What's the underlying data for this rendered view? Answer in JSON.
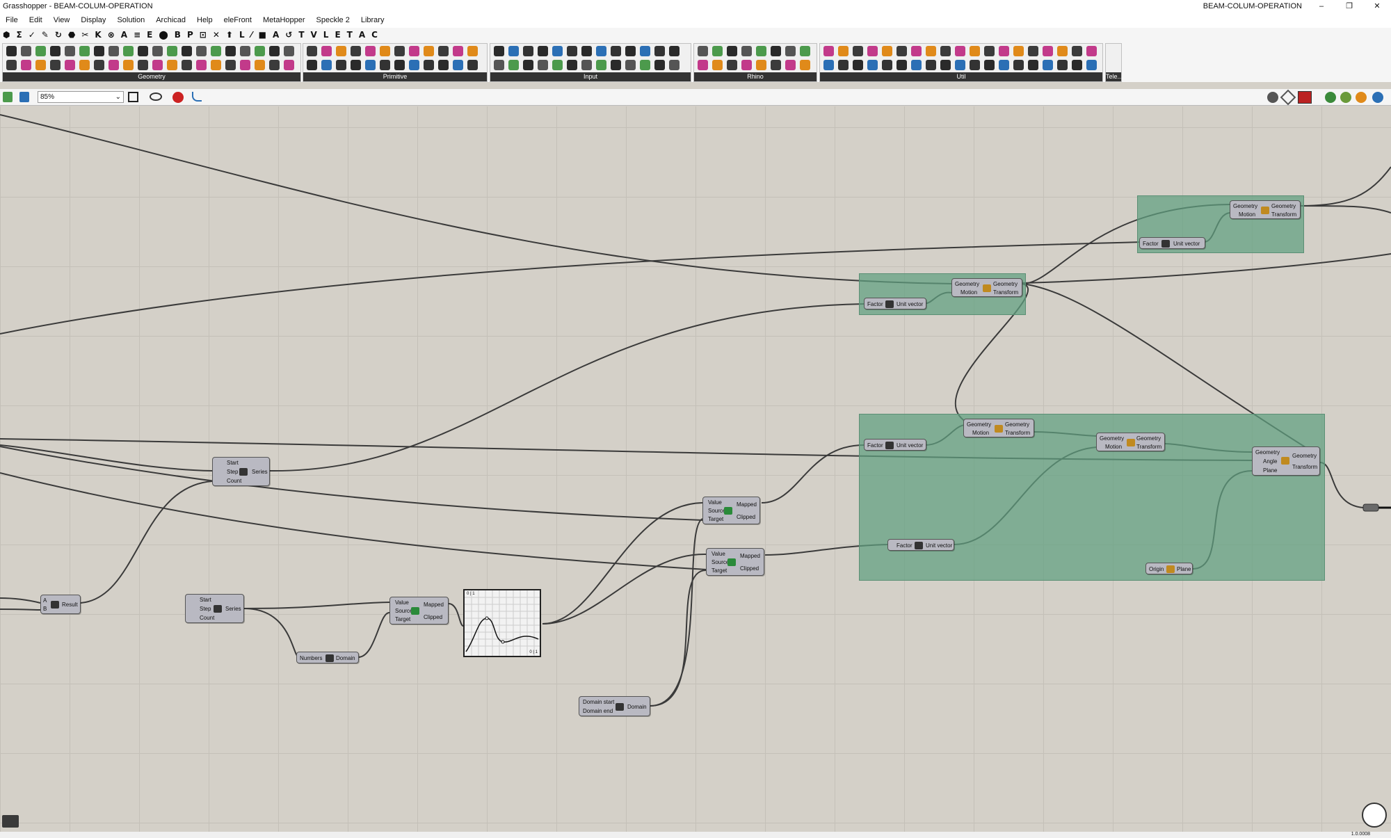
{
  "window": {
    "title": "Grasshopper - BEAM-COLUM-OPERATION",
    "document_name": "BEAM-COLUM-OPERATION",
    "buttons": [
      "–",
      "❐",
      "✕"
    ]
  },
  "menu": [
    "File",
    "Edit",
    "View",
    "Display",
    "Solution",
    "Archicad",
    "Help",
    "eleFront",
    "MetaHopper",
    "Speckle 2",
    "Library"
  ],
  "tabs": [
    "⬢",
    "Σ",
    "✓",
    "✎",
    "↻",
    "⬣",
    "✂",
    "K",
    "⊗",
    "A",
    "≡",
    "E",
    "⬤",
    "B",
    "P",
    "⊡",
    "✕",
    "⬆",
    "L",
    "⁄",
    "■",
    "A",
    "↺",
    "T",
    "V",
    "L",
    "E",
    "T",
    "A",
    "C"
  ],
  "ribbon": {
    "panels": [
      "Geometry",
      "Primitive",
      "Input",
      "Rhino",
      "Util",
      "Tele..."
    ]
  },
  "canvas_toolbar": {
    "zoom": "85%"
  },
  "nodes": {
    "multiply": {
      "in": [
        "A",
        "B"
      ],
      "out": "Result"
    },
    "series1": {
      "in": [
        "Start",
        "Step",
        "Count"
      ],
      "out": "Series"
    },
    "series2": {
      "in": [
        "Start",
        "Step",
        "Count"
      ],
      "out": "Series"
    },
    "bounds": {
      "in": "Numbers",
      "out": "Domain"
    },
    "remap1": {
      "in": [
        "Value",
        "Source",
        "Target"
      ],
      "out": [
        "Mapped",
        "Clipped"
      ]
    },
    "remap2": {
      "in": [
        "Value",
        "Source",
        "Target"
      ],
      "out": [
        "Mapped",
        "Clipped"
      ]
    },
    "remap3": {
      "in": [
        "Value",
        "Source",
        "Target"
      ],
      "out": [
        "Mapped",
        "Clipped"
      ]
    },
    "domain": {
      "in": [
        "Domain start",
        "Domain end"
      ],
      "out": "Domain"
    },
    "unit_z1": {
      "in": "Factor",
      "out": "Unit vector"
    },
    "unit_x1": {
      "in": "Factor",
      "out": "Unit vector"
    },
    "unit_z2": {
      "in": "Factor",
      "out": "Unit vector"
    },
    "unit_y": {
      "in": "Factor",
      "out": "Unit vector"
    },
    "move1": {
      "in": [
        "Geometry",
        "Motion"
      ],
      "out": [
        "Geometry",
        "Transform"
      ]
    },
    "move2": {
      "in": [
        "Geometry",
        "Motion"
      ],
      "out": [
        "Geometry",
        "Transform"
      ]
    },
    "move3": {
      "in": [
        "Geometry",
        "Motion"
      ],
      "out": [
        "Geometry",
        "Transform"
      ]
    },
    "move4": {
      "in": [
        "Geometry",
        "Motion"
      ],
      "out": [
        "Geometry",
        "Transform"
      ]
    },
    "rotate": {
      "in": [
        "Geometry",
        "Angle",
        "Plane"
      ],
      "out": [
        "Geometry",
        "Transform"
      ]
    },
    "xyplane": {
      "in": "Origin",
      "out": "Plane"
    }
  },
  "graph_mapper": {
    "corner_tl": "0 | 1",
    "corner_br": "0 | 1"
  },
  "status": {
    "version": "1.0.0008"
  }
}
